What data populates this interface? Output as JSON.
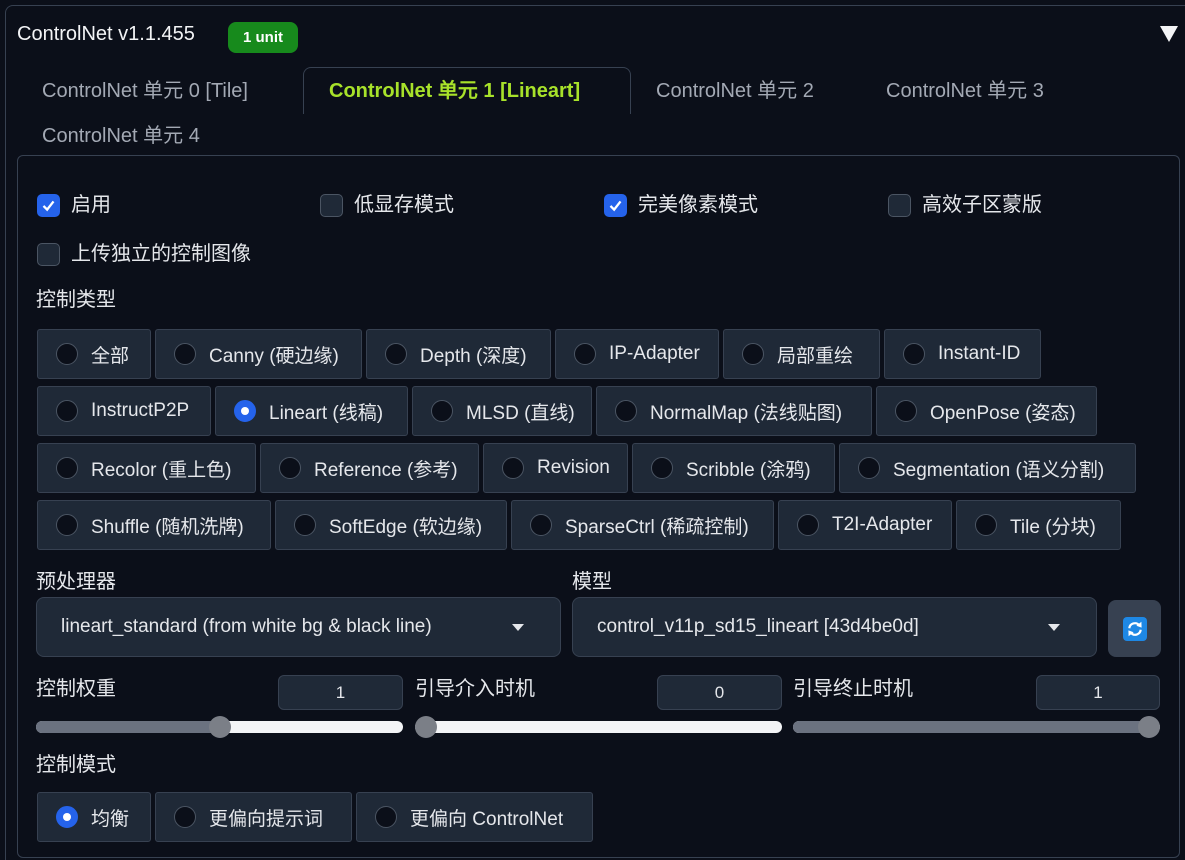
{
  "header": {
    "title": "ControlNet v1.1.455",
    "badge": "1 unit",
    "collapse_icon": "triangle-down-icon"
  },
  "tabs": [
    {
      "label": "ControlNet 单元 0 [Tile]",
      "selected": false
    },
    {
      "label": "ControlNet 单元 1 [Lineart]",
      "selected": true
    },
    {
      "label": "ControlNet 单元 2",
      "selected": false
    },
    {
      "label": "ControlNet 单元 3",
      "selected": false
    },
    {
      "label": "ControlNet 单元 4",
      "selected": false
    }
  ],
  "checkboxes": [
    {
      "label": "启用",
      "checked": true
    },
    {
      "label": "低显存模式",
      "checked": false
    },
    {
      "label": "完美像素模式",
      "checked": true
    },
    {
      "label": "高效子区蒙版",
      "checked": false
    },
    {
      "label": "上传独立的控制图像",
      "checked": false
    }
  ],
  "control_type": {
    "label": "控制类型",
    "options": [
      {
        "label": "全部",
        "selected": false
      },
      {
        "label": "Canny (硬边缘)",
        "selected": false
      },
      {
        "label": "Depth (深度)",
        "selected": false
      },
      {
        "label": "IP-Adapter",
        "selected": false
      },
      {
        "label": "局部重绘",
        "selected": false
      },
      {
        "label": "Instant-ID",
        "selected": false
      },
      {
        "label": "InstructP2P",
        "selected": false
      },
      {
        "label": "Lineart (线稿)",
        "selected": true
      },
      {
        "label": "MLSD (直线)",
        "selected": false
      },
      {
        "label": "NormalMap (法线贴图)",
        "selected": false
      },
      {
        "label": "OpenPose (姿态)",
        "selected": false
      },
      {
        "label": "Recolor (重上色)",
        "selected": false
      },
      {
        "label": "Reference (参考)",
        "selected": false
      },
      {
        "label": "Revision",
        "selected": false
      },
      {
        "label": "Scribble (涂鸦)",
        "selected": false
      },
      {
        "label": "Segmentation (语义分割)",
        "selected": false
      },
      {
        "label": "Shuffle (随机洗牌)",
        "selected": false
      },
      {
        "label": "SoftEdge (软边缘)",
        "selected": false
      },
      {
        "label": "SparseCtrl (稀疏控制)",
        "selected": false
      },
      {
        "label": "T2I-Adapter",
        "selected": false
      },
      {
        "label": "Tile (分块)",
        "selected": false
      }
    ]
  },
  "preprocessor": {
    "label": "预处理器",
    "value": "lineart_standard (from white bg & black line)",
    "dropdown_icon": "chevron-down-icon"
  },
  "model": {
    "label": "模型",
    "value": "control_v11p_sd15_lineart [43d4be0d]",
    "dropdown_icon": "chevron-down-icon",
    "refresh_icon": "refresh-icon"
  },
  "sliders": [
    {
      "label": "控制权重",
      "value": "1",
      "fill_fraction": 0.5
    },
    {
      "label": "引导介入时机",
      "value": "0",
      "fill_fraction": 0
    },
    {
      "label": "引导终止时机",
      "value": "1",
      "fill_fraction": 1
    }
  ],
  "control_mode": {
    "label": "控制模式",
    "options": [
      {
        "label": "均衡",
        "selected": true
      },
      {
        "label": "更偏向提示词",
        "selected": false
      },
      {
        "label": "更偏向 ControlNet",
        "selected": false
      }
    ]
  },
  "colors": {
    "background": "#0b0f19",
    "accent": "#2563eb",
    "selected_tab_text": "#a8e22a",
    "badge": "#178a1c"
  }
}
